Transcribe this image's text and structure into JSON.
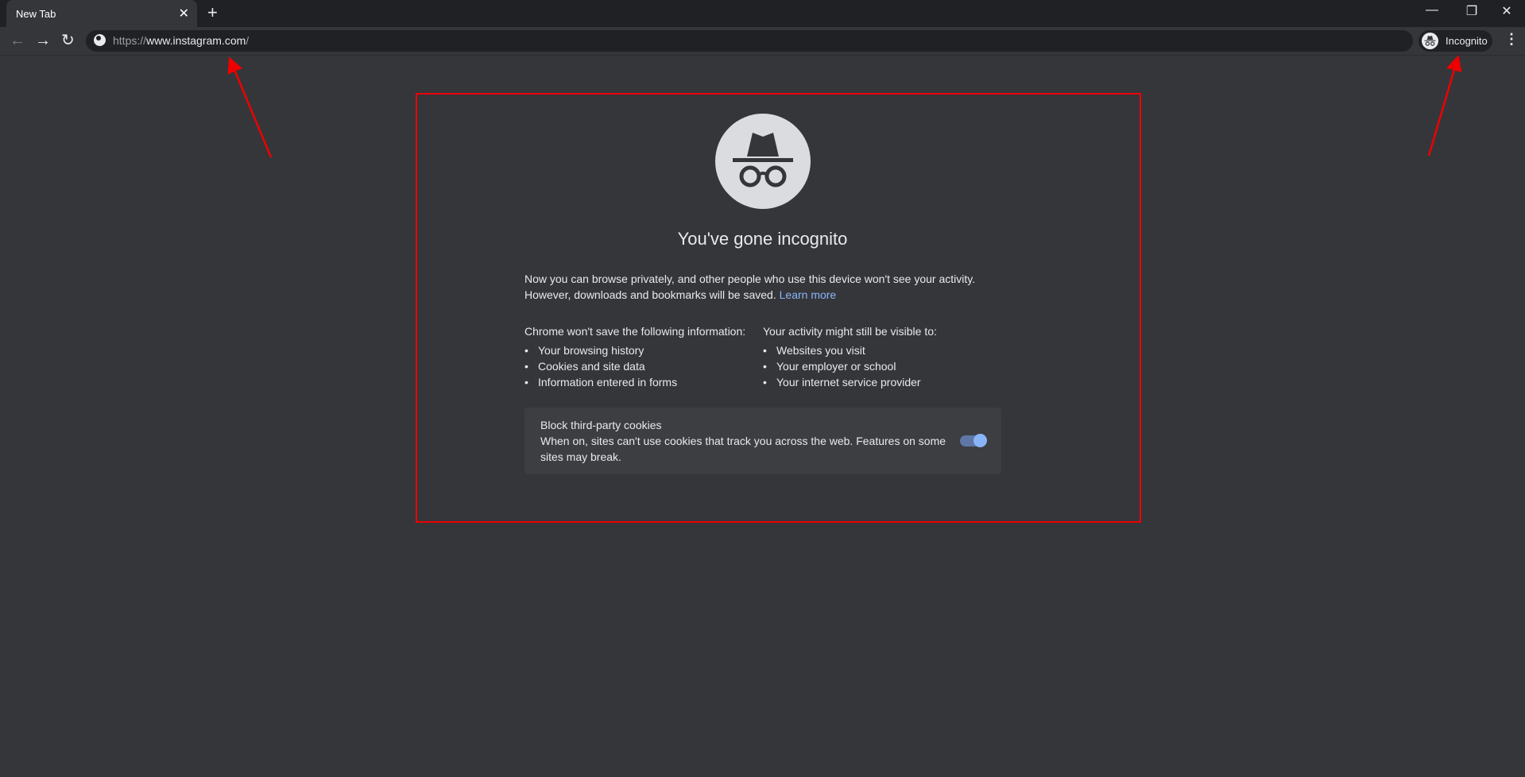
{
  "tab": {
    "title": "New Tab"
  },
  "window": {
    "minimize": "—",
    "restore": "❐",
    "close": "✕"
  },
  "toolbar": {
    "url_scheme": "https://",
    "url_host": "www.instagram.com",
    "url_path": "/",
    "profile_label": "Incognito"
  },
  "page": {
    "title": "You've gone incognito",
    "intro": "Now you can browse privately, and other people who use this device won't see your activity. However, downloads and bookmarks will be saved.",
    "learn_more": "Learn more",
    "left_heading": "Chrome won't save the following information:",
    "left_items": [
      "Your browsing history",
      "Cookies and site data",
      "Information entered in forms"
    ],
    "right_heading": "Your activity might still be visible to:",
    "right_items": [
      "Websites you visit",
      "Your employer or school",
      "Your internet service provider"
    ],
    "cookies": {
      "title": "Block third-party cookies",
      "description": "When on, sites can't use cookies that track you across the web. Features on some sites may break.",
      "enabled": true
    }
  },
  "colors": {
    "annotation": "#e00000",
    "link": "#8ab4f8",
    "background": "#35363a"
  }
}
